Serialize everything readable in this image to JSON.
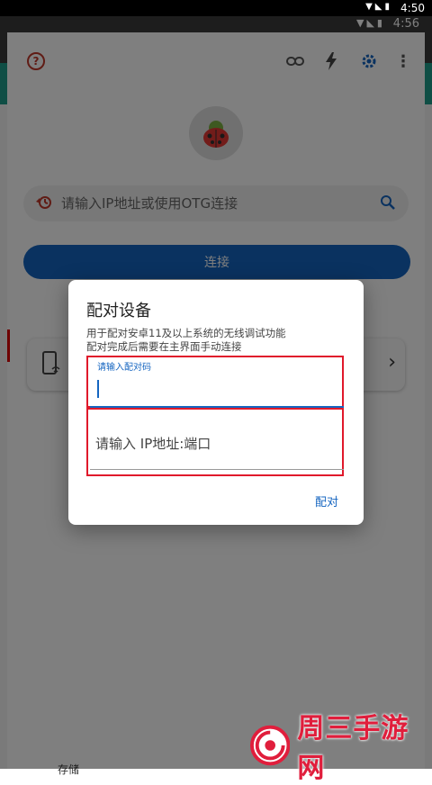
{
  "outer_status": {
    "time": "4:50"
  },
  "inner_status": {
    "time": "4:56"
  },
  "toolbar": {
    "icons": [
      "help-icon",
      "link-icon",
      "flash-icon",
      "gear-icon",
      "more-icon"
    ]
  },
  "search": {
    "placeholder": "请输入IP地址或使用OTG连接"
  },
  "connect_button": {
    "label": "连接"
  },
  "dialog": {
    "title": "配对设备",
    "message_line1": "用于配对安卓11及以上系统的无线调试功能",
    "message_line2": "配对完成后需要在主界面手动连接",
    "pair_code_label": "请输入配对码",
    "ip_placeholder": "请输入 IP地址:端口",
    "confirm_label": "配对"
  },
  "bottom": {
    "partial_label": "存储"
  },
  "watermark": {
    "text": "周三手游网"
  },
  "colors": {
    "accent": "#1565c0",
    "highlight_red": "#e0192b",
    "teal": "#1f9c8a",
    "help_red": "#c0392b"
  }
}
